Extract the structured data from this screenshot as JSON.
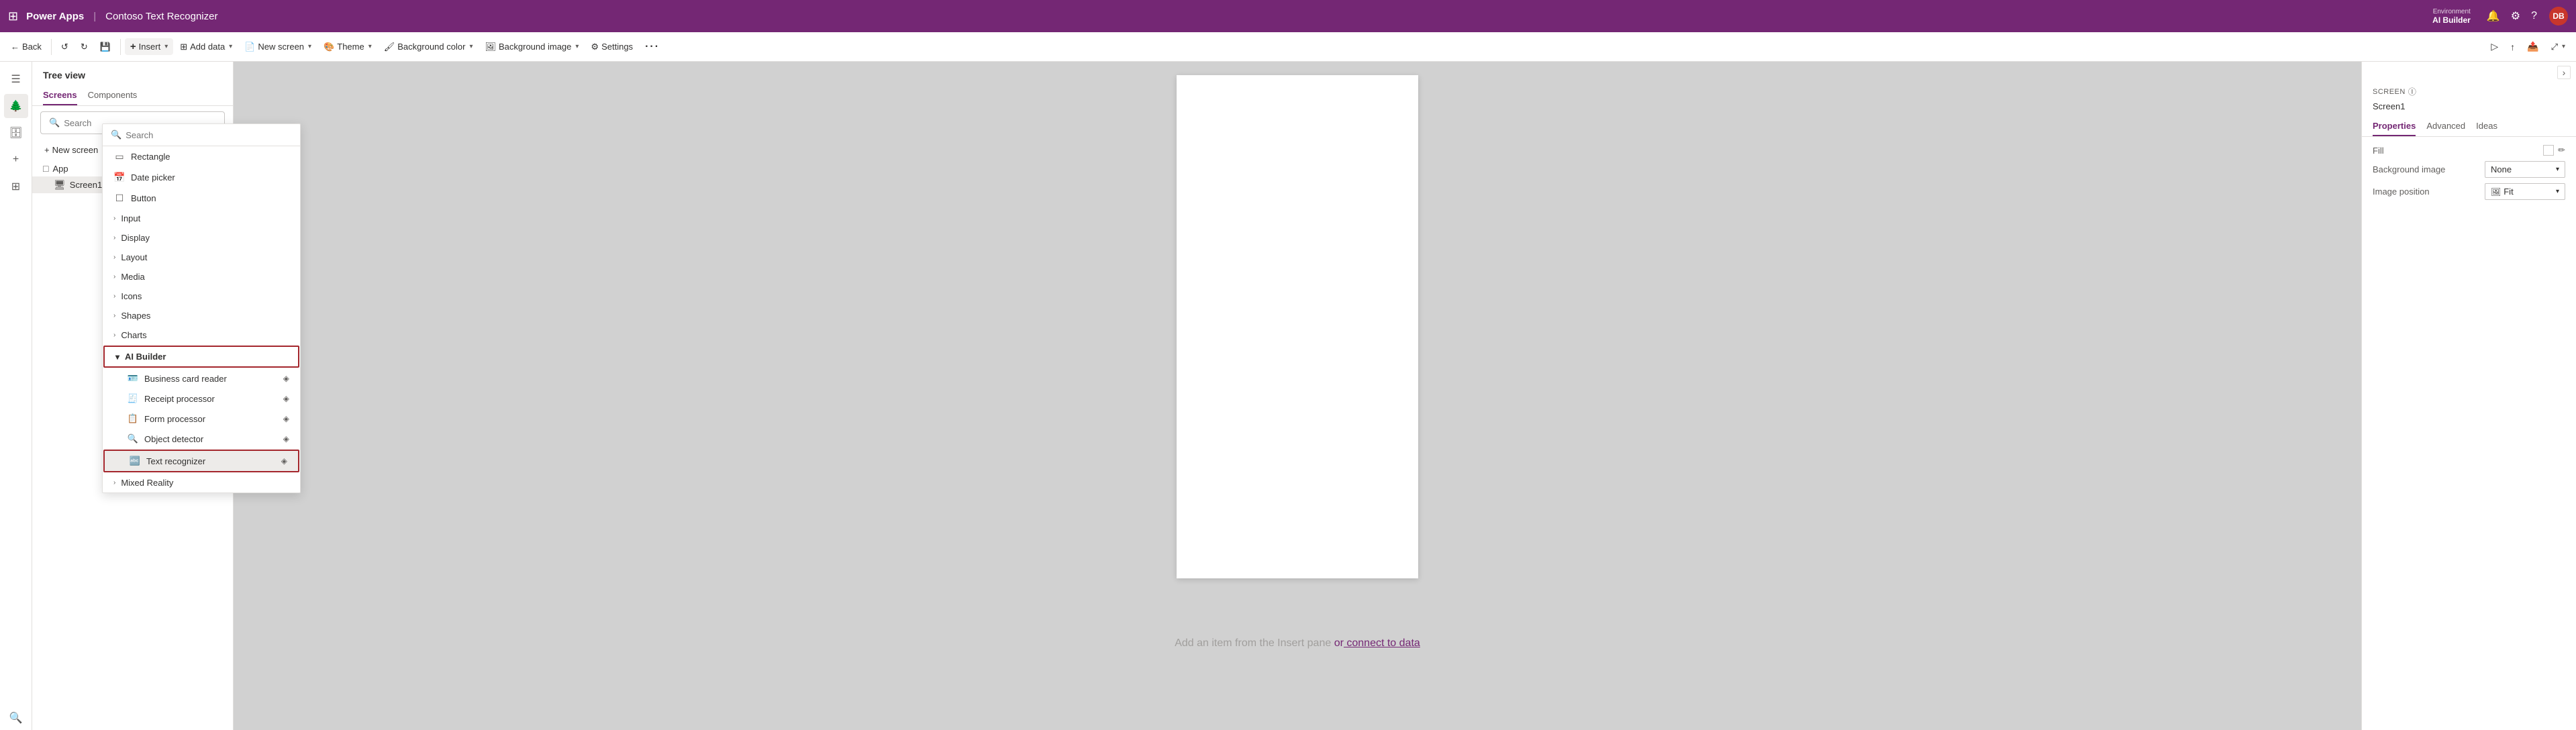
{
  "titlebar": {
    "app_name": "Power Apps",
    "separator": "|",
    "project_name": "Contoso Text Recognizer",
    "environment_label": "Environment",
    "environment_name": "AI Builder",
    "avatar_initials": "DB"
  },
  "toolbar": {
    "back_label": "Back",
    "insert_label": "Insert",
    "add_data_label": "Add data",
    "new_screen_label": "New screen",
    "theme_label": "Theme",
    "background_color_label": "Background color",
    "background_image_label": "Background image",
    "settings_label": "Settings",
    "more_label": "..."
  },
  "formula_bar": {
    "collapse_label": "›"
  },
  "tree_panel": {
    "header": "Tree view",
    "tab_screens": "Screens",
    "tab_components": "Components",
    "search_placeholder": "Search",
    "new_screen_label": "New screen",
    "app_item": "App",
    "screen1_item": "Screen1"
  },
  "insert_menu": {
    "search_placeholder": "Search",
    "items": [
      {
        "id": "rectangle",
        "label": "Rectangle",
        "icon": "▭"
      },
      {
        "id": "date-picker",
        "label": "Date picker",
        "icon": "📅"
      },
      {
        "id": "button",
        "label": "Button",
        "icon": "⬜"
      }
    ],
    "categories": [
      {
        "id": "input",
        "label": "Input",
        "expanded": false
      },
      {
        "id": "display",
        "label": "Display",
        "expanded": false
      },
      {
        "id": "layout",
        "label": "Layout",
        "expanded": false
      },
      {
        "id": "media",
        "label": "Media",
        "expanded": false
      },
      {
        "id": "icons",
        "label": "Icons",
        "expanded": false
      },
      {
        "id": "shapes",
        "label": "Shapes",
        "expanded": false
      },
      {
        "id": "charts",
        "label": "Charts",
        "expanded": false
      }
    ],
    "ai_builder": {
      "label": "AI Builder",
      "expanded": true,
      "sub_items": [
        {
          "id": "business-card-reader",
          "label": "Business card reader",
          "premium": true
        },
        {
          "id": "receipt-processor",
          "label": "Receipt processor",
          "premium": true
        },
        {
          "id": "form-processor",
          "label": "Form processor",
          "premium": true
        },
        {
          "id": "object-detector",
          "label": "Object detector",
          "premium": true
        },
        {
          "id": "text-recognizer",
          "label": "Text recognizer",
          "premium": true,
          "highlighted": true
        }
      ]
    },
    "mixed_reality": {
      "label": "Mixed Reality",
      "expanded": false
    }
  },
  "canvas": {
    "placeholder_text": "Add an item from the Insert pane ",
    "placeholder_or": "or",
    "placeholder_link": " connect to data"
  },
  "properties_panel": {
    "screen_label": "SCREEN",
    "screen_name": "Screen1",
    "tabs": [
      "Properties",
      "Advanced",
      "Ideas"
    ],
    "active_tab": "Properties",
    "fill_label": "Fill",
    "background_image_label": "Background image",
    "background_image_value": "None",
    "image_position_label": "Image position",
    "image_position_value": "Fit",
    "image_position_icon": "🖼"
  },
  "icons": {
    "grid": "⊞",
    "back_arrow": "←",
    "undo": "↺",
    "redo": "↻",
    "save": "💾",
    "tree": "☰",
    "data": "🗄",
    "insert_plus": "+",
    "brush": "🖌",
    "component": "⊞",
    "search_glass": "🔍",
    "chevron_down": "▾",
    "chevron_right": "›",
    "chevron_left": "‹",
    "expand": "⤢",
    "star": "★",
    "sparkle": "✦",
    "lightning": "⚡",
    "bell": "🔔",
    "gear": "⚙",
    "question": "?",
    "premium_diamond": "◈",
    "info_circle": "ⓘ",
    "paint_fill": "🎨",
    "calendar": "📅",
    "shape_rect": "▭",
    "button_icon": "☐",
    "ai_icon": "🤖",
    "card_icon": "🪪",
    "receipt_icon": "🧾",
    "form_icon": "📋",
    "detector_icon": "🔍",
    "text_rec_icon": "🔤"
  }
}
